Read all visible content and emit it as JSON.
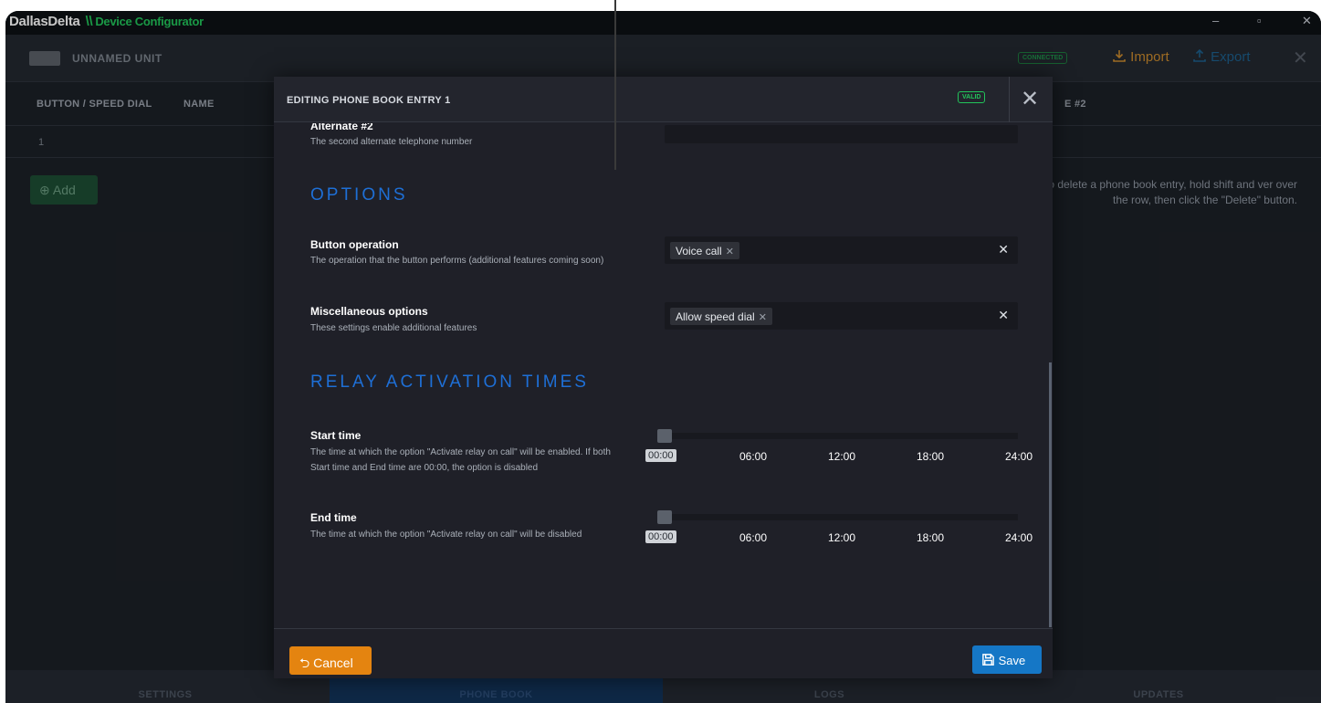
{
  "app": {
    "brand": "DallasDelta",
    "separator": "\\\\",
    "subtitle": "Device Configurator",
    "minimize": "–",
    "restore": "▫",
    "close": "✕"
  },
  "unit": {
    "name": "UNNAMED UNIT",
    "status": "CONNECTED",
    "import_label": "Import",
    "export_label": "Export",
    "close": "✕"
  },
  "table": {
    "columns": [
      "BUTTON / SPEED DIAL",
      "NAME",
      "E #2"
    ],
    "rows": [
      {
        "button": "1"
      }
    ],
    "add_label": "Add",
    "hint": "To delete a phone book entry, hold shift and ver over the row, then click the \"Delete\" button."
  },
  "tabs": [
    {
      "label": "SETTINGS",
      "active": false
    },
    {
      "label": "PHONE BOOK",
      "active": true
    },
    {
      "label": "LOGS",
      "active": false
    },
    {
      "label": "UPDATES",
      "active": false
    }
  ],
  "modal": {
    "title": "EDITING PHONE BOOK ENTRY 1",
    "badge": "VALID",
    "close": "✕",
    "alternate2": {
      "label": "Alternate #2",
      "desc": "The second alternate telephone number",
      "value": ""
    },
    "options_heading": "OPTIONS",
    "button_operation": {
      "label": "Button operation",
      "desc": "The operation that the button performs (additional features coming soon)",
      "chip": "Voice call"
    },
    "misc_options": {
      "label": "Miscellaneous options",
      "desc": "These settings enable additional features",
      "chip": "Allow speed dial"
    },
    "relay_heading": "RELAY ACTIVATION TIMES",
    "start_time": {
      "label": "Start time",
      "desc": "The time at which the option \"Activate relay on call\" will be enabled. If both Start time and End time are 00:00, the option is disabled",
      "value": "00:00",
      "value_fraction": 0
    },
    "end_time": {
      "label": "End time",
      "desc": "The time at which the option \"Activate relay on call\" will be disabled",
      "value": "00:00",
      "value_fraction": 0
    },
    "ticks": [
      "06:00",
      "12:00",
      "18:00",
      "24:00"
    ],
    "cancel_label": "Cancel",
    "save_label": "Save"
  },
  "colors": {
    "brand_green": "#22c45a",
    "section_blue": "#1e6fd6",
    "cancel_orange": "#e48410",
    "save_blue": "#1577c6"
  }
}
